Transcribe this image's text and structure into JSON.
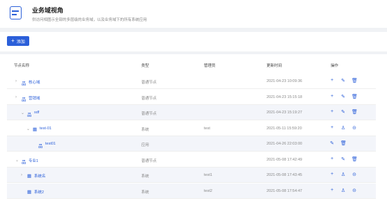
{
  "header": {
    "title": "业务域视角",
    "subtitle": "供访问相图示全部的多层级的业务域，以及业务域下的所有系统应用"
  },
  "toolbar": {
    "add_label": "添加"
  },
  "table": {
    "columns": [
      "节点名称",
      "类型",
      "管理员",
      "更新时间",
      "操作"
    ],
    "rows": [
      {
        "caret": "›",
        "icon": "品",
        "name": "核心域",
        "type": "普通节点",
        "owner": "",
        "time": "2021-04-23 10:09:36",
        "actions": [
          "plus-icon",
          "edit-icon",
          "delete-icon"
        ]
      },
      {
        "caret": "›",
        "icon": "品",
        "name": "营销域",
        "type": "普通节点",
        "owner": "",
        "time": "2021-04-23 15:15:18",
        "actions": [
          "plus-icon",
          "edit-icon",
          "delete-icon"
        ]
      },
      {
        "caret": "⌄",
        "icon": "品",
        "name": "sdf",
        "type": "普通节点",
        "owner": "",
        "time": "2021-04-23 15:19:27",
        "actions": [
          "plus-icon",
          "edit-icon",
          "delete-icon"
        ]
      },
      {
        "caret": "⌄",
        "icon": "▦",
        "name": "test-01",
        "type": "系统",
        "owner": "test",
        "time": "2021-05-11 15:59:20",
        "actions": [
          "plus-icon",
          "user-icon",
          "link-icon"
        ]
      },
      {
        "caret": "",
        "icon": "品",
        "name": "test01",
        "type": "应用",
        "owner": "",
        "time": "2021-04-26 22:03:00",
        "actions": [
          "edit-icon",
          "delete-icon"
        ]
      },
      {
        "caret": "⌄",
        "icon": "品",
        "name": "专业1",
        "type": "普通节点",
        "owner": "",
        "time": "2021-05-08 17:42:49",
        "actions": [
          "plus-icon",
          "edit-icon",
          "delete-icon"
        ]
      },
      {
        "caret": "›",
        "icon": "▦",
        "name": "系统名",
        "type": "系统",
        "owner": "test1",
        "time": "2021-05-08 17:43:45",
        "actions": [
          "plus-icon",
          "user-icon",
          "link-icon"
        ]
      },
      {
        "caret": "",
        "icon": "▦",
        "name": "系统2",
        "type": "系统",
        "owner": "test2",
        "time": "2021-05-08 17:54:47",
        "actions": [
          "plus-icon",
          "user-icon",
          "link-icon"
        ]
      }
    ]
  }
}
